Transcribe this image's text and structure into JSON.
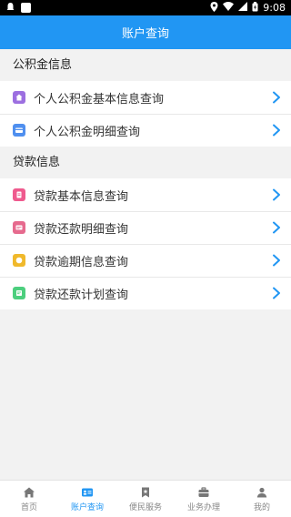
{
  "status_bar": {
    "time": "9:08"
  },
  "app_bar": {
    "title": "账户查询"
  },
  "sections": [
    {
      "title": "公积金信息",
      "items": [
        {
          "label": "个人公积金基本信息查询",
          "icon": "house-icon",
          "color": "#9c6fe0"
        },
        {
          "label": "个人公积金明细查询",
          "icon": "card-icon",
          "color": "#4f8fef"
        }
      ]
    },
    {
      "title": "贷款信息",
      "items": [
        {
          "label": "贷款基本信息查询",
          "icon": "document-icon",
          "color": "#ef5a8e"
        },
        {
          "label": "贷款还款明细查询",
          "icon": "receipt-icon",
          "color": "#e66a8e"
        },
        {
          "label": "贷款逾期信息查询",
          "icon": "clock-icon",
          "color": "#f0b92c"
        },
        {
          "label": "贷款还款计划查询",
          "icon": "plan-icon",
          "color": "#4ccf7e"
        }
      ]
    }
  ],
  "bottom_nav": [
    {
      "label": "首页",
      "icon": "home-icon",
      "active": false
    },
    {
      "label": "账户查询",
      "icon": "account-card-icon",
      "active": true
    },
    {
      "label": "便民服务",
      "icon": "bookmark-icon",
      "active": false
    },
    {
      "label": "业务办理",
      "icon": "briefcase-icon",
      "active": false
    },
    {
      "label": "我的",
      "icon": "user-icon",
      "active": false
    }
  ],
  "colors": {
    "accent": "#2196f3",
    "chevron": "#2196f3"
  }
}
